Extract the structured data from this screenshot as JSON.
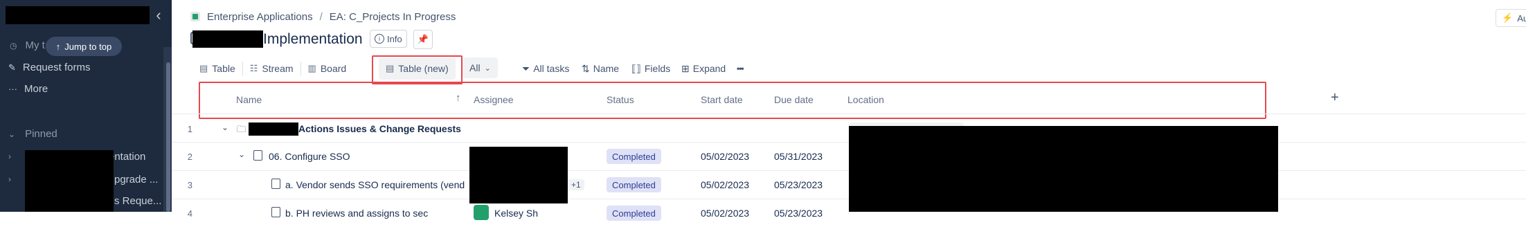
{
  "sidebar": {
    "items": {
      "my_label": "My t",
      "request_forms": "Request forms",
      "more": "More",
      "pinned": "Pinned"
    },
    "jump_to_top": "Jump to top",
    "pinned_items": [
      {
        "label": "entation"
      },
      {
        "label": "pgrade ..."
      },
      {
        "label": "s Reque..."
      }
    ]
  },
  "breadcrumb": {
    "items": [
      "Enterprise Applications",
      "EA: C_Projects In Progress"
    ],
    "separator": "/"
  },
  "header": {
    "title_suffix": "Implementation",
    "info_label": "Info",
    "top_right_label": "Au"
  },
  "views": {
    "tabs": [
      "Table",
      "Stream",
      "Board",
      "Table (new)"
    ],
    "filter_label": "All"
  },
  "toolbar": {
    "all_tasks": "All tasks",
    "name": "Name",
    "fields": "Fields",
    "expand": "Expand",
    "more": "•••"
  },
  "table": {
    "columns": [
      "Name",
      "Assignee",
      "Status",
      "Start date",
      "Due date",
      "Location"
    ],
    "add_column": "+",
    "rows": [
      {
        "num": "1",
        "name": "Actions Issues & Change Requests",
        "assignee": "",
        "status": "",
        "start": "",
        "due": "",
        "location": ""
      },
      {
        "num": "2",
        "name": "06. Configure SSO",
        "assignee": "",
        "status": "Completed",
        "start": "05/02/2023",
        "due": "05/31/2023",
        "location": ""
      },
      {
        "num": "3",
        "name": "a. Vendor sends SSO requirements (vend",
        "assignee": "+1",
        "status": "Completed",
        "start": "05/02/2023",
        "due": "05/23/2023",
        "location": ""
      },
      {
        "num": "4",
        "name": "b. PH reviews and assigns to sec",
        "assignee": "Kelsey Sh",
        "status": "Completed",
        "start": "05/02/2023",
        "due": "05/23/2023",
        "location": ""
      }
    ]
  },
  "colors": {
    "sidebar_bg": "#1e2a3d",
    "highlight": "#e5484d",
    "status_badge_bg": "#dfe1f7",
    "assignee_avatar": "#22a06b"
  }
}
